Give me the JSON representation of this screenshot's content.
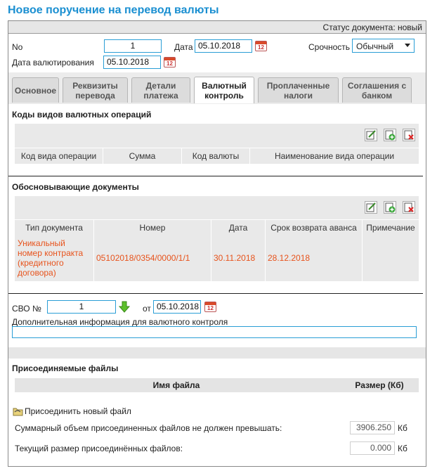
{
  "page": {
    "title": "Новое поручение на перевод валюты"
  },
  "status": {
    "text": "Статус документа: новый"
  },
  "header": {
    "no_label": "No",
    "no_value": "1",
    "date_label": "Дата",
    "date_value": "05.10.2018",
    "urgency_label": "Срочность",
    "urgency_value": "Обычный",
    "value_date_label": "Дата валютирования",
    "value_date_value": "05.10.2018",
    "calendar_day": "12"
  },
  "tabs": [
    {
      "label": "Основное"
    },
    {
      "label": "Реквизиты перевода"
    },
    {
      "label": "Детали платежа"
    },
    {
      "label": "Валютный контроль"
    },
    {
      "label": "Проплаченные налоги"
    },
    {
      "label": "Соглашения с банком"
    }
  ],
  "ops": {
    "title": "Коды видов валютных операций",
    "columns": [
      "Код вида операции",
      "Сумма",
      "Код валюты",
      "Наименование вида операции"
    ]
  },
  "docs": {
    "title": "Обосновывающие документы",
    "columns": [
      "Тип документа",
      "Номер",
      "Дата",
      "Срок возврата аванса",
      "Примечание"
    ],
    "rows": [
      {
        "type": "Уникальный номер контракта (кредитного договора)",
        "number": "05102018/0354/0000/1/1",
        "date": "30.11.2018",
        "due": "28.12.2018",
        "note": ""
      }
    ]
  },
  "svo": {
    "label": "СВО №",
    "value": "1",
    "from_label": "от",
    "date_value": "05.10.2018",
    "extra_label": "Дополнительная информация для валютного контроля",
    "extra_value": ""
  },
  "files": {
    "title": "Присоединяемые файлы",
    "col_name": "Имя файла",
    "col_size": "Размер (Кб)",
    "attach_label": "Присоединить новый файл",
    "limit_label": "Суммарный объем присоединенных файлов не должен превышать:",
    "limit_value": "3906.250",
    "current_label": "Текущий размер присоединённых файлов:",
    "current_value": "0.000",
    "unit": "Кб"
  },
  "colors": {
    "accent": "#1a8fd1",
    "link": "#e8531c",
    "input_border": "#2a9ed6"
  }
}
